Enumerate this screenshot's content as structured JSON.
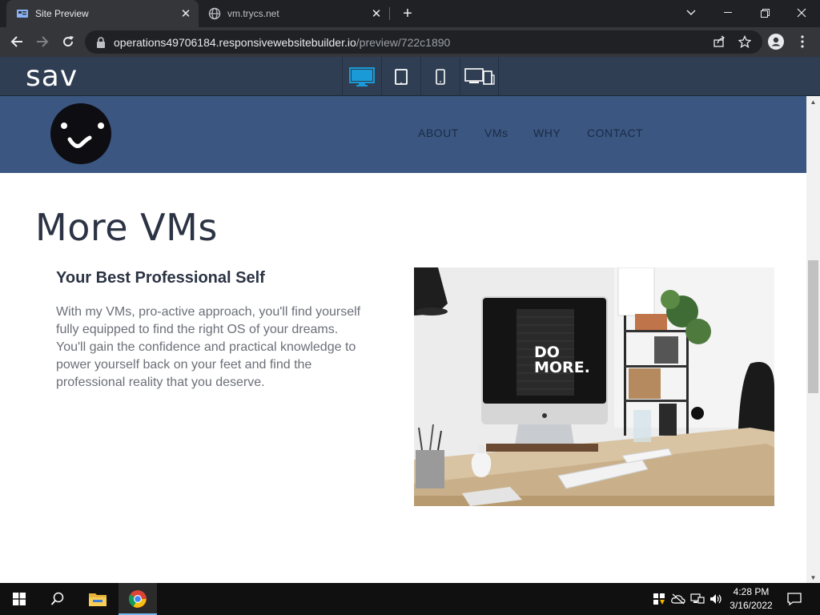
{
  "browser": {
    "tabs": [
      {
        "title": "Site Preview",
        "active": true
      },
      {
        "title": "vm.trycs.net",
        "active": false
      }
    ],
    "url_host": "operations49706184.responsivewebsitebuilder.io",
    "url_path": "/preview/722c1890"
  },
  "builder": {
    "brand": "sav",
    "devices": [
      "desktop-icon",
      "tablet-icon",
      "mobile-icon",
      "multi-device-icon"
    ],
    "accent_color": "#1a9bd7"
  },
  "site": {
    "nav": [
      "ABOUT",
      "VMs",
      "WHY",
      "CONTACT"
    ],
    "page_title": "More VMs",
    "section_title": "Your Best Professional Self",
    "body": "With my VMs, pro-active approach, you'll find yourself fully equipped to find the right OS of your dreams. You'll gain the confidence and practical knowledge to power yourself back on your feet and find the professional reality that you deserve.",
    "image_text": [
      "DO",
      "MORE."
    ],
    "header_color": "#3b5680"
  },
  "taskbar": {
    "time": "4:28 PM",
    "date": "3/16/2022"
  }
}
